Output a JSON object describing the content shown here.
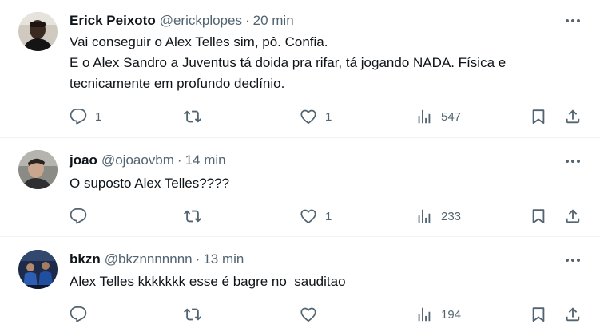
{
  "tweets": [
    {
      "name": "Erick Peixoto",
      "handle": "@erickplopes",
      "separator": "·",
      "time": "20 min",
      "lines": [
        "Vai conseguir o Alex Telles sim, pô. Confia.",
        "E o Alex Sandro a Juventus tá doida pra rifar, tá jogando NADA. Física e",
        "tecnicamente em profundo declínio."
      ],
      "replies": "1",
      "retweets": "",
      "likes": "1",
      "views": "547"
    },
    {
      "name": "joao",
      "handle": "@ojoaovbm",
      "separator": "·",
      "time": "14 min",
      "lines": [
        "O suposto Alex Telles????"
      ],
      "replies": "",
      "retweets": "",
      "likes": "1",
      "views": "233"
    },
    {
      "name": "bkzn",
      "handle": "@bkznnnnnnn",
      "separator": "·",
      "time": "13 min",
      "lines": [
        "Alex Telles kkkkkkk esse é bagre no  sauditao"
      ],
      "replies": "",
      "retweets": "",
      "likes": "",
      "views": "194"
    }
  ],
  "icons": {
    "reply": "reply-icon",
    "retweet": "retweet-icon",
    "like": "heart-icon",
    "views": "views-chart-icon",
    "bookmark": "bookmark-icon",
    "share": "share-icon",
    "more": "more-dots-icon"
  },
  "colors": {
    "text": "#0f1419",
    "secondary": "#536471",
    "divider": "#eff3f4"
  }
}
